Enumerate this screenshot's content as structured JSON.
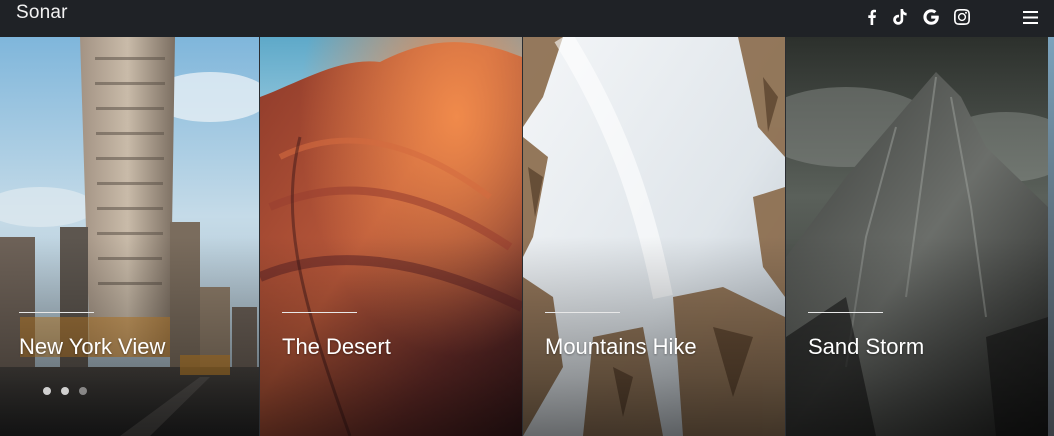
{
  "navbar": {
    "brand": "Sonar",
    "social": [
      {
        "icon": "facebook-icon"
      },
      {
        "icon": "tiktok-icon"
      },
      {
        "icon": "google-icon"
      },
      {
        "icon": "instagram-icon"
      }
    ],
    "menu_icon": "hamburger-menu-icon"
  },
  "gallery": {
    "cards": [
      {
        "title": "New York View",
        "scene": "city-street-flatiron"
      },
      {
        "title": "The Desert",
        "scene": "red-sandstone-canyon"
      },
      {
        "title": "Mountains Hike",
        "scene": "snowy-rocky-mountain"
      },
      {
        "title": "Sand Storm",
        "scene": "dark-misty-peak"
      }
    ],
    "pagination": {
      "count": 3,
      "active": 0
    }
  },
  "colors": {
    "navbar_bg": "#1f2226",
    "text": "#ffffff"
  }
}
